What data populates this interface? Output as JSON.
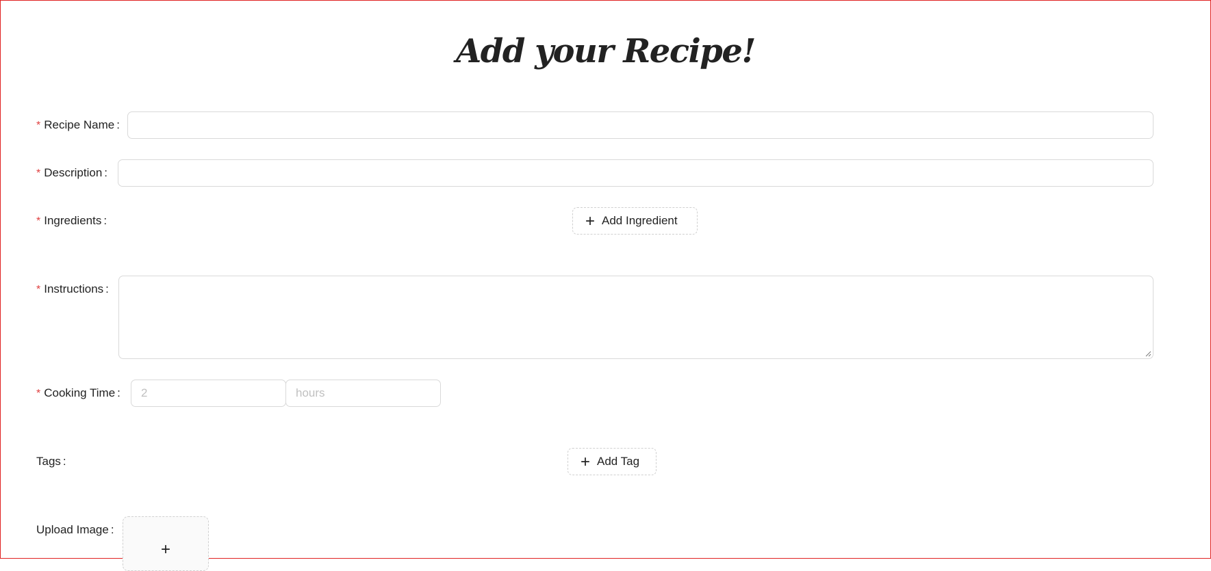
{
  "title": "Add your Recipe!",
  "form": {
    "recipe_name": {
      "label": "Recipe Name",
      "value": "",
      "required": true
    },
    "description": {
      "label": "Description",
      "value": "",
      "required": true
    },
    "ingredients": {
      "label": "Ingredients",
      "button_label": "Add Ingredient",
      "required": true
    },
    "instructions": {
      "label": "Instructions",
      "value": "",
      "required": true
    },
    "cooking_time": {
      "label": "Cooking Time",
      "amount_placeholder": "2",
      "unit_placeholder": "hours",
      "required": true
    },
    "tags": {
      "label": "Tags",
      "button_label": "Add Tag",
      "required": false
    },
    "upload_image": {
      "label": "Upload Image",
      "required": false
    }
  },
  "colon": ":",
  "required_mark": "*",
  "plus_glyph": "+",
  "colors": {
    "required": "#e04040",
    "frame_border": "#e02020",
    "input_border": "#d9d9d9"
  }
}
